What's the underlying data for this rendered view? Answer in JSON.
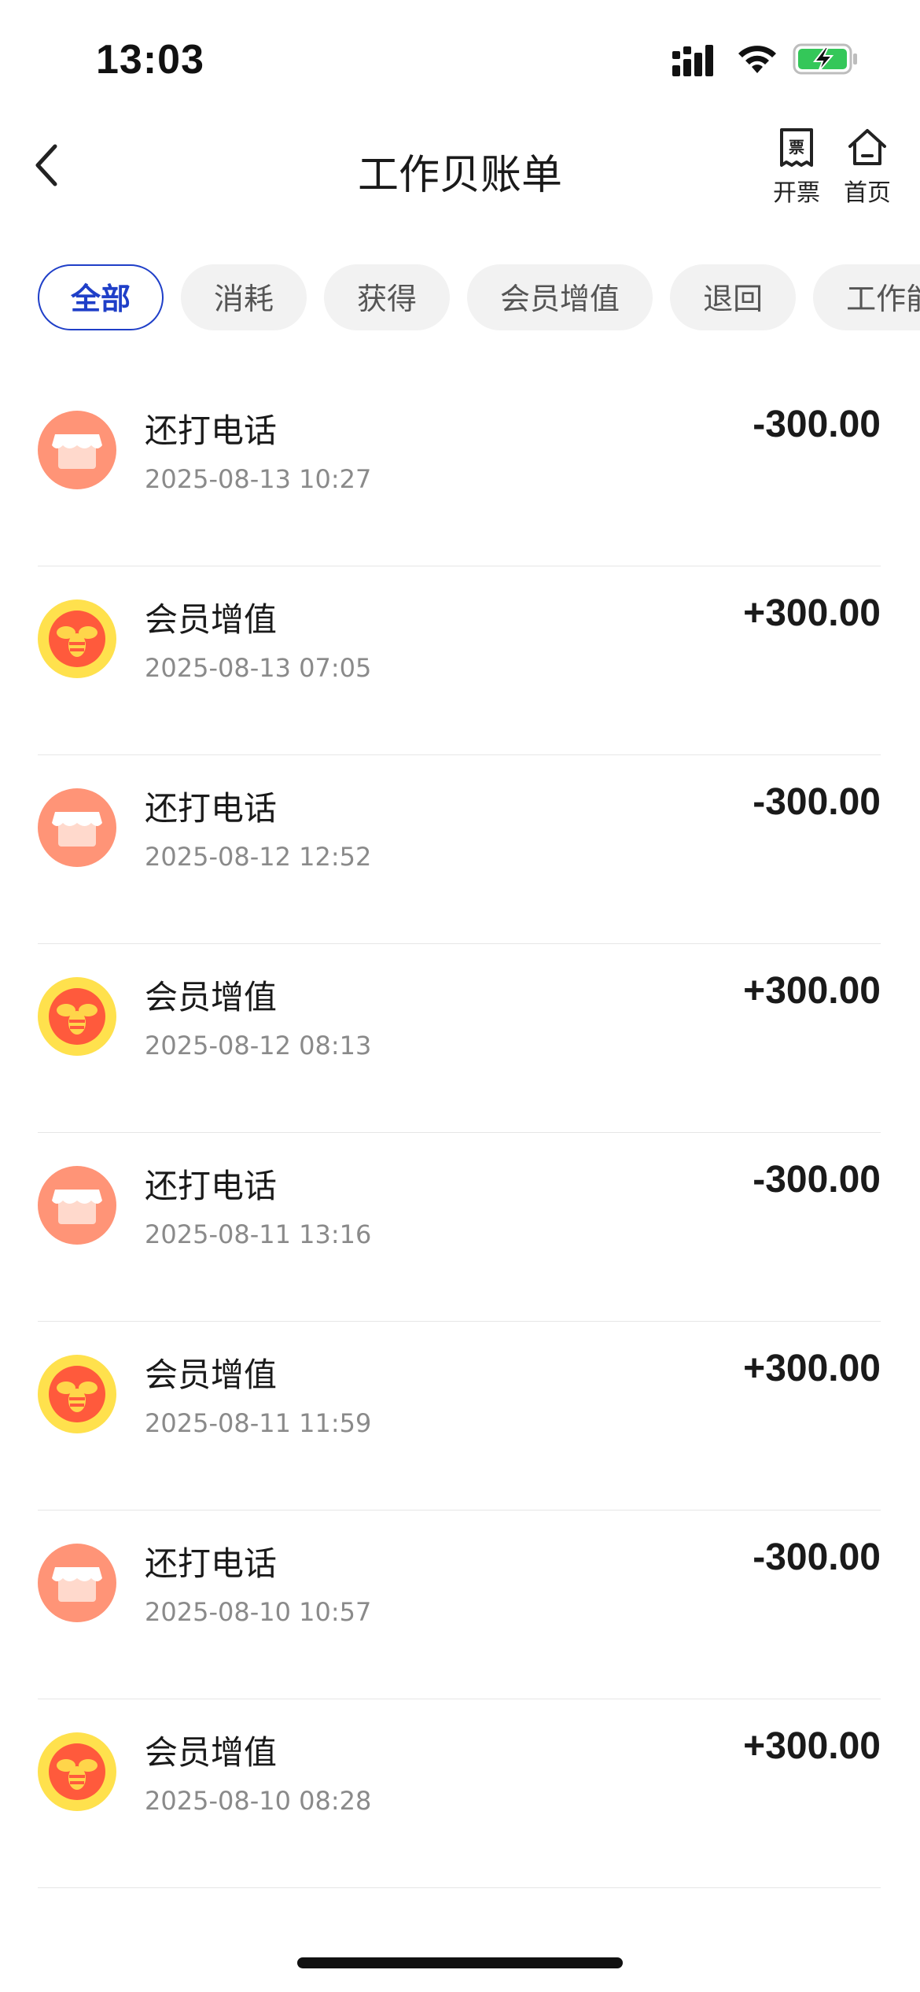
{
  "status_bar": {
    "time": "13:03",
    "icons": [
      "cellular-signal-icon",
      "wifi-icon",
      "battery-charging-icon"
    ],
    "battery_color": "#34c759"
  },
  "nav": {
    "title": "工作贝账单",
    "back_icon": "chevron-left-icon",
    "invoice_label": "开票",
    "invoice_glyph": "票",
    "home_label": "首页"
  },
  "tabs": [
    {
      "label": "全部",
      "active": true
    },
    {
      "label": "消耗",
      "active": false
    },
    {
      "label": "获得",
      "active": false
    },
    {
      "label": "会员增值",
      "active": false
    },
    {
      "label": "退回",
      "active": false
    },
    {
      "label": "工作能量",
      "active": false
    }
  ],
  "colors": {
    "accent": "#1f3fc8",
    "spend_icon_bg": "#ff9477",
    "gain_icon_bg": "#ffe14d",
    "gain_icon_inner": "#ff5a3c"
  },
  "transactions": [
    {
      "type": "spend",
      "icon": "shop-icon",
      "title": "还打电话",
      "time": "2025-08-13 10:27",
      "amount": "-300.00"
    },
    {
      "type": "gain",
      "icon": "bee-coin-icon",
      "title": "会员增值",
      "time": "2025-08-13 07:05",
      "amount": "+300.00"
    },
    {
      "type": "spend",
      "icon": "shop-icon",
      "title": "还打电话",
      "time": "2025-08-12 12:52",
      "amount": "-300.00"
    },
    {
      "type": "gain",
      "icon": "bee-coin-icon",
      "title": "会员增值",
      "time": "2025-08-12 08:13",
      "amount": "+300.00"
    },
    {
      "type": "spend",
      "icon": "shop-icon",
      "title": "还打电话",
      "time": "2025-08-11 13:16",
      "amount": "-300.00"
    },
    {
      "type": "gain",
      "icon": "bee-coin-icon",
      "title": "会员增值",
      "time": "2025-08-11 11:59",
      "amount": "+300.00"
    },
    {
      "type": "spend",
      "icon": "shop-icon",
      "title": "还打电话",
      "time": "2025-08-10 10:57",
      "amount": "-300.00"
    },
    {
      "type": "gain",
      "icon": "bee-coin-icon",
      "title": "会员增值",
      "time": "2025-08-10 08:28",
      "amount": "+300.00"
    }
  ]
}
